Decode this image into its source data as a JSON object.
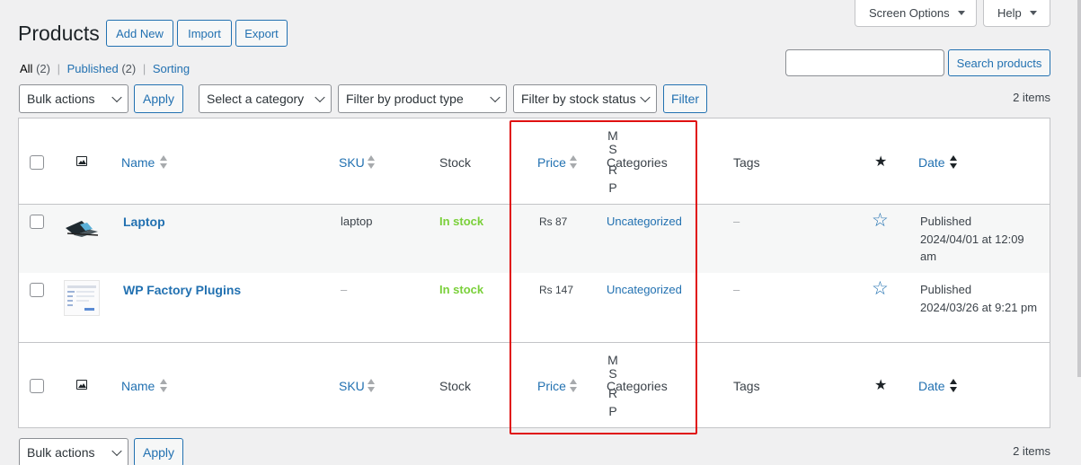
{
  "header": {
    "title": "Products",
    "add_new": "Add New",
    "import": "Import",
    "export": "Export",
    "screen_options": "Screen Options",
    "help": "Help"
  },
  "subsubsub": {
    "all_label": "All",
    "all_count": "(2)",
    "published_label": "Published",
    "published_count": "(2)",
    "sorting_label": "Sorting",
    "separator": "|"
  },
  "search": {
    "value": "",
    "button": "Search products"
  },
  "filters": {
    "bulk_actions": "Bulk actions",
    "apply": "Apply",
    "category": "Select a category",
    "product_type": "Filter by product type",
    "stock_status": "Filter by stock status",
    "filter_button": "Filter",
    "items_count": "2 items"
  },
  "columns": {
    "name": "Name",
    "sku": "SKU",
    "stock": "Stock",
    "price": "Price",
    "msrp_letters": [
      "M",
      "S",
      "R",
      "P"
    ],
    "categories": "Categories",
    "tags": "Tags",
    "date": "Date"
  },
  "rows": [
    {
      "name": "Laptop",
      "sku": "laptop",
      "stock": "In stock",
      "price": "Rs 87",
      "category": "Uncategorized",
      "tags": "–",
      "date_status": "Published",
      "date_line1": "2024/04/01 at 12:09",
      "date_line2": "am"
    },
    {
      "name": "WP Factory Plugins",
      "sku": "–",
      "stock": "In stock",
      "price": "Rs 147",
      "category": "Uncategorized",
      "tags": "–",
      "date_status": "Published",
      "date_line1": "2024/03/26 at 9:21 pm",
      "date_line2": ""
    }
  ],
  "colors": {
    "link": "#2271b1",
    "in_stock": "#7ad03a",
    "highlight_box": "#e01010"
  }
}
